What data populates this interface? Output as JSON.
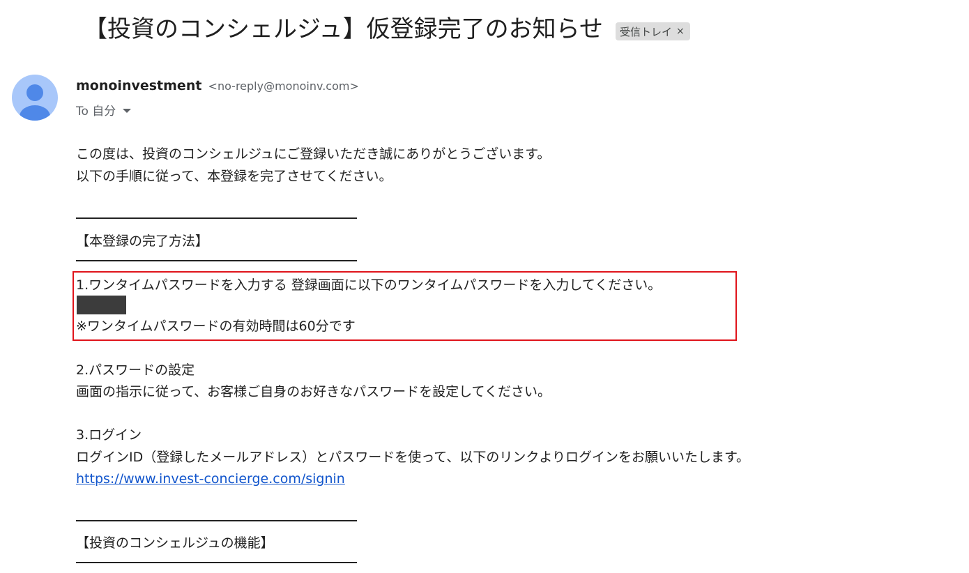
{
  "email": {
    "subject": "【投資のコンシェルジュ】仮登録完了のお知らせ",
    "label": "受信トレイ",
    "label_remove": "×",
    "sender_name": "monoinvestment",
    "sender_email": "<no-reply@monoinv.com>",
    "recipient": "To 自分",
    "avatar_icon": "person-icon",
    "avatar_color": "#a8c7fa",
    "avatar_figure_color": "#4f88e8"
  },
  "body": {
    "greeting_1": "この度は、投資のコンシェルジュにご登録いただき誠にありがとうございます。",
    "greeting_2": "以下の手順に従って、本登録を完了させてください。",
    "section1_title": "【本登録の完了方法】",
    "step1_text": "1.ワンタイムパスワードを入力する 登録画面に以下のワンタイムパスワードを入力してください。",
    "step1_note": "※ワンタイムパスワードの有効時間は60分です",
    "step2_title": "2.パスワードの設定",
    "step2_text": "画面の指示に従って、お客様ご自身のお好きなパスワードを設定してください。",
    "step3_title": "3.ログイン",
    "step3_text": "ログインID（登録したメールアドレス）とパスワードを使って、以下のリンクよりログインをお願いいたします。",
    "signin_link": "https://www.invest-concierge.com/signin",
    "section2_title": "【投資のコンシェルジュの機能】"
  },
  "colors": {
    "highlight_border": "#e0141b",
    "link": "#1155cc",
    "redaction": "#3c3c3c"
  }
}
